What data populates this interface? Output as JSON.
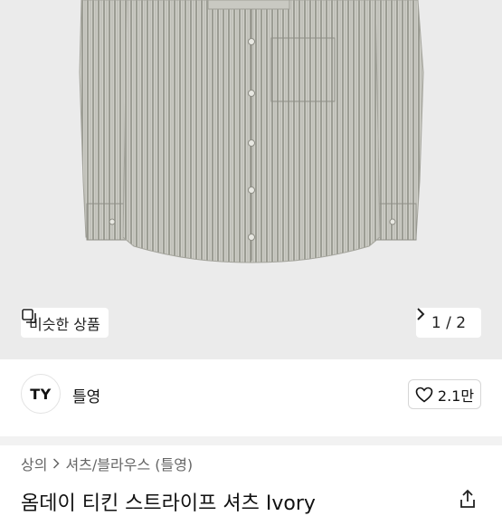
{
  "product_image": {
    "alt_icon": "striped-shirt-image"
  },
  "similar_button": {
    "icon": "similar-items-icon",
    "label": "비슷한 상품"
  },
  "pager": {
    "text": "1 / 2",
    "icon": "chevron-right-icon"
  },
  "seller": {
    "avatar_text": "TY",
    "name": "틀영"
  },
  "like_button": {
    "icon": "heart-icon",
    "count": "2.1만"
  },
  "breadcrumb": {
    "items": [
      "상의",
      "셔츠/블라우스 (틀영)"
    ],
    "separator_icon": "chevron-right-icon"
  },
  "product": {
    "title": "옴데이 티킨 스트라이프 셔츠 Ivory",
    "share_icon": "share-icon"
  }
}
